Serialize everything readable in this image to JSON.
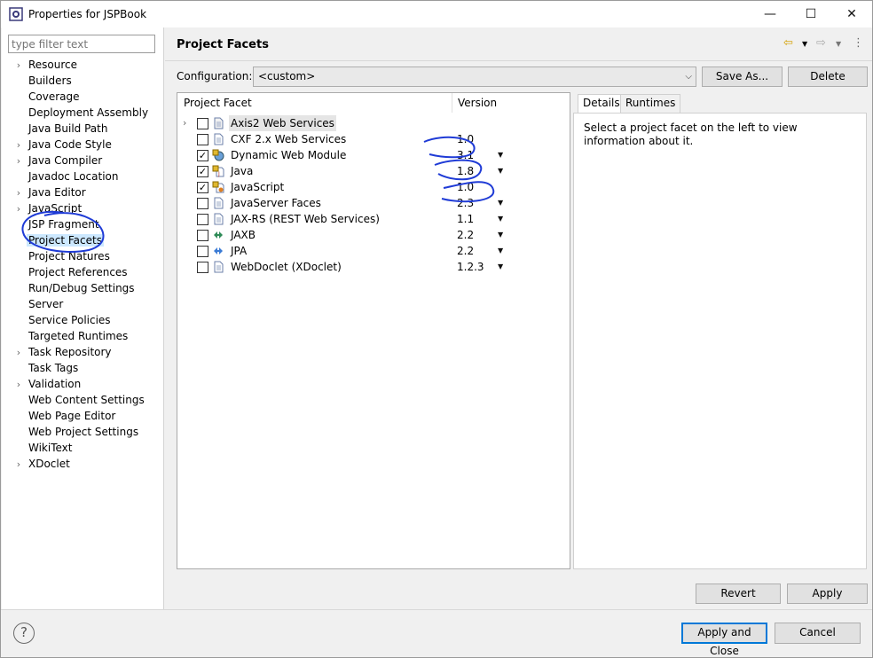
{
  "window": {
    "title": "Properties for JSPBook",
    "minimize_glyph": "—",
    "maximize_glyph": "☐",
    "close_glyph": "✕"
  },
  "filter": {
    "placeholder": "type filter text"
  },
  "nav": [
    {
      "label": "Resource",
      "expandable": true
    },
    {
      "label": "Builders",
      "expandable": false
    },
    {
      "label": "Coverage",
      "expandable": false
    },
    {
      "label": "Deployment Assembly",
      "expandable": false
    },
    {
      "label": "Java Build Path",
      "expandable": false
    },
    {
      "label": "Java Code Style",
      "expandable": true
    },
    {
      "label": "Java Compiler",
      "expandable": true
    },
    {
      "label": "Javadoc Location",
      "expandable": false
    },
    {
      "label": "Java Editor",
      "expandable": true
    },
    {
      "label": "JavaScript",
      "expandable": true
    },
    {
      "label": "JSP Fragment",
      "expandable": false
    },
    {
      "label": "Project Facets",
      "expandable": false,
      "selected": true
    },
    {
      "label": "Project Natures",
      "expandable": false
    },
    {
      "label": "Project References",
      "expandable": false
    },
    {
      "label": "Run/Debug Settings",
      "expandable": false
    },
    {
      "label": "Server",
      "expandable": false
    },
    {
      "label": "Service Policies",
      "expandable": false
    },
    {
      "label": "Targeted Runtimes",
      "expandable": false
    },
    {
      "label": "Task Repository",
      "expandable": true
    },
    {
      "label": "Task Tags",
      "expandable": false
    },
    {
      "label": "Validation",
      "expandable": true
    },
    {
      "label": "Web Content Settings",
      "expandable": false
    },
    {
      "label": "Web Page Editor",
      "expandable": false
    },
    {
      "label": "Web Project Settings",
      "expandable": false
    },
    {
      "label": "WikiText",
      "expandable": false
    },
    {
      "label": "XDoclet",
      "expandable": true
    }
  ],
  "page": {
    "title": "Project Facets",
    "config_label": "Configuration:",
    "config_value": "<custom>",
    "save_as": "Save As...",
    "delete": "Delete"
  },
  "facets_table": {
    "col_facet": "Project Facet",
    "col_version": "Version",
    "rows": [
      {
        "name": "Axis2 Web Services",
        "version": "",
        "checked": false,
        "expandable": true,
        "icon": "folder-page-icon",
        "dropdown": false
      },
      {
        "name": "CXF 2.x Web Services",
        "version": "1.0",
        "checked": false,
        "expandable": false,
        "icon": "page-icon",
        "dropdown": false
      },
      {
        "name": "Dynamic Web Module",
        "version": "3.1",
        "checked": true,
        "expandable": false,
        "icon": "lock-globe-icon",
        "dropdown": true
      },
      {
        "name": "Java",
        "version": "1.8",
        "checked": true,
        "expandable": false,
        "icon": "lock-java-icon",
        "dropdown": true
      },
      {
        "name": "JavaScript",
        "version": "1.0",
        "checked": true,
        "expandable": false,
        "icon": "lock-js-icon",
        "dropdown": false
      },
      {
        "name": "JavaServer Faces",
        "version": "2.3",
        "checked": false,
        "expandable": false,
        "icon": "page-icon",
        "dropdown": true
      },
      {
        "name": "JAX-RS (REST Web Services)",
        "version": "1.1",
        "checked": false,
        "expandable": false,
        "icon": "page-icon",
        "dropdown": true
      },
      {
        "name": "JAXB",
        "version": "2.2",
        "checked": false,
        "expandable": false,
        "icon": "jaxb-icon",
        "dropdown": true
      },
      {
        "name": "JPA",
        "version": "2.2",
        "checked": false,
        "expandable": false,
        "icon": "jpa-icon",
        "dropdown": true
      },
      {
        "name": "WebDoclet (XDoclet)",
        "version": "1.2.3",
        "checked": false,
        "expandable": false,
        "icon": "page-icon",
        "dropdown": true
      }
    ]
  },
  "details": {
    "tab_details": "Details",
    "tab_runtimes": "Runtimes",
    "text": "Select a project facet on the left to view information about it."
  },
  "buttons": {
    "revert": "Revert",
    "apply": "Apply",
    "apply_close": "Apply and Close",
    "cancel": "Cancel",
    "help_glyph": "?"
  },
  "colors": {
    "selection": "#cce8ff",
    "ink": "#1f3bd6",
    "default_button_border": "#0078d7"
  }
}
